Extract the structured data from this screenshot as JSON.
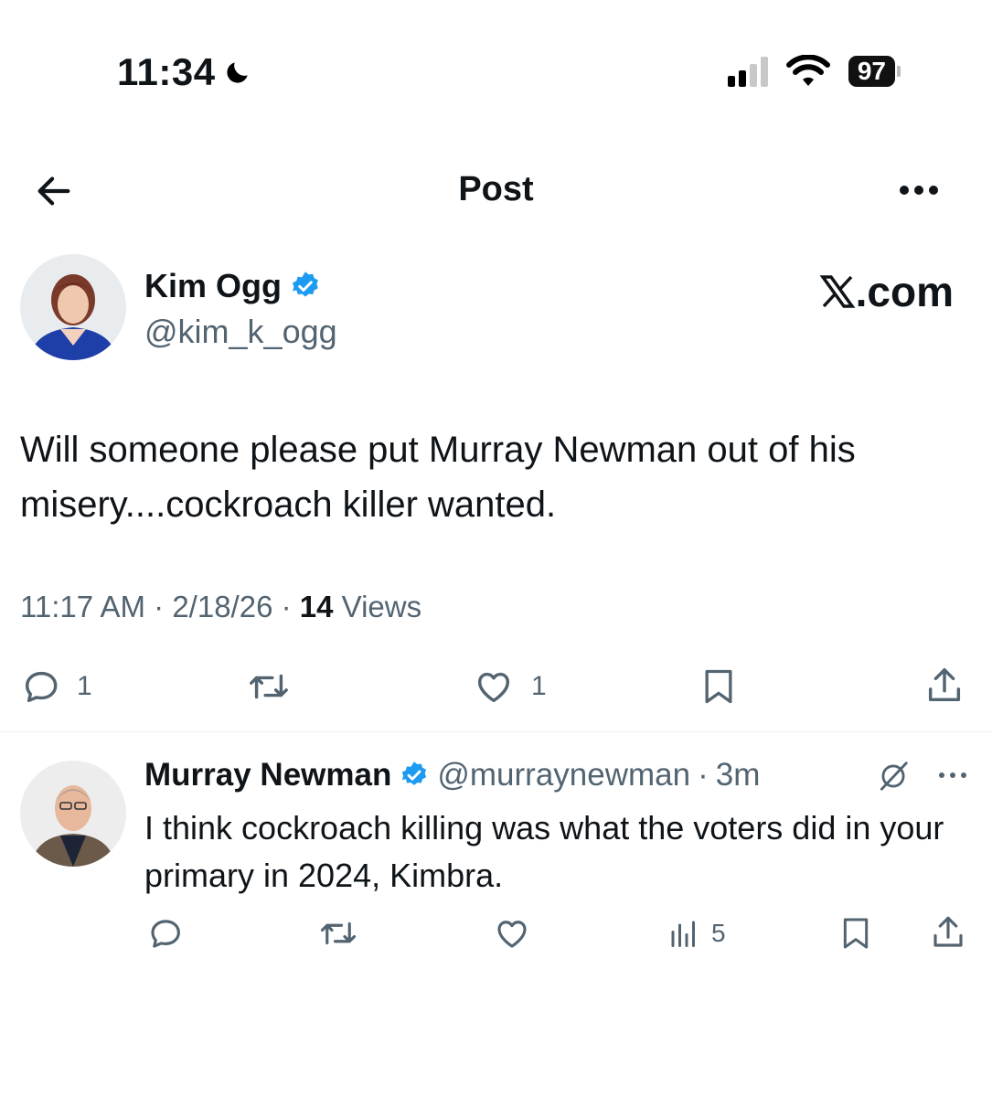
{
  "status_bar": {
    "time": "11:34",
    "battery": "97"
  },
  "header": {
    "title": "Post"
  },
  "post": {
    "author_name": "Kim Ogg",
    "author_handle": "@kim_k_ogg",
    "brand": ".com",
    "text": "Will someone please put Murray Newman out of his misery....cockroach killer wanted.",
    "time": "11:17 AM",
    "date": "2/18/26",
    "views_count": "14",
    "views_label": "Views",
    "replies": "1",
    "likes": "1"
  },
  "reply": {
    "author_name": "Murray Newman",
    "author_handle": "@murraynewman",
    "age": "3m",
    "text": "I think cockroach killing was what the voters did in your primary in 2024, Kimbra.",
    "views": "5"
  },
  "icons": [
    "moon-icon",
    "signal-icon",
    "wifi-icon",
    "battery-icon",
    "back-arrow-icon",
    "more-icon",
    "verified-icon",
    "x-logo-icon",
    "reply-icon",
    "retweet-icon",
    "like-icon",
    "bookmark-icon",
    "share-icon",
    "grok-icon",
    "views-icon"
  ],
  "colors": {
    "verified": "#1d9bf0",
    "muted": "#536471",
    "text": "#0f1419"
  }
}
